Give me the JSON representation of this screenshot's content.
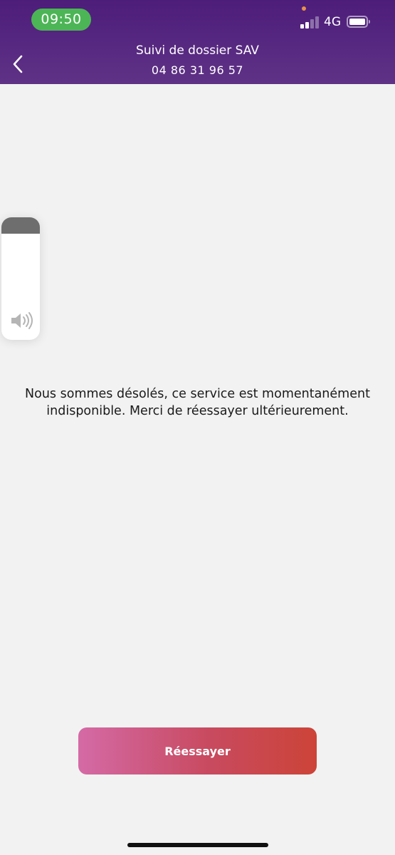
{
  "status_bar": {
    "time": "09:50",
    "network": "4G",
    "signal_bars_active": 2,
    "signal_bars_total": 4,
    "time_pill_color": "#4cb556"
  },
  "header": {
    "title": "Suivi de dossier SAV",
    "phone": "04 86 31 96 57",
    "back_icon": "chevron-left-icon",
    "background_color": "#4d1d7a"
  },
  "volume_hud": {
    "icon": "speaker-icon"
  },
  "message": {
    "text": "Nous sommes désolés, ce service est momentanément indisponible. Merci de réessayer ultérieurement."
  },
  "retry_button": {
    "label": "Réessayer",
    "gradient_start": "#d46aa6",
    "gradient_end": "#cc4438"
  }
}
